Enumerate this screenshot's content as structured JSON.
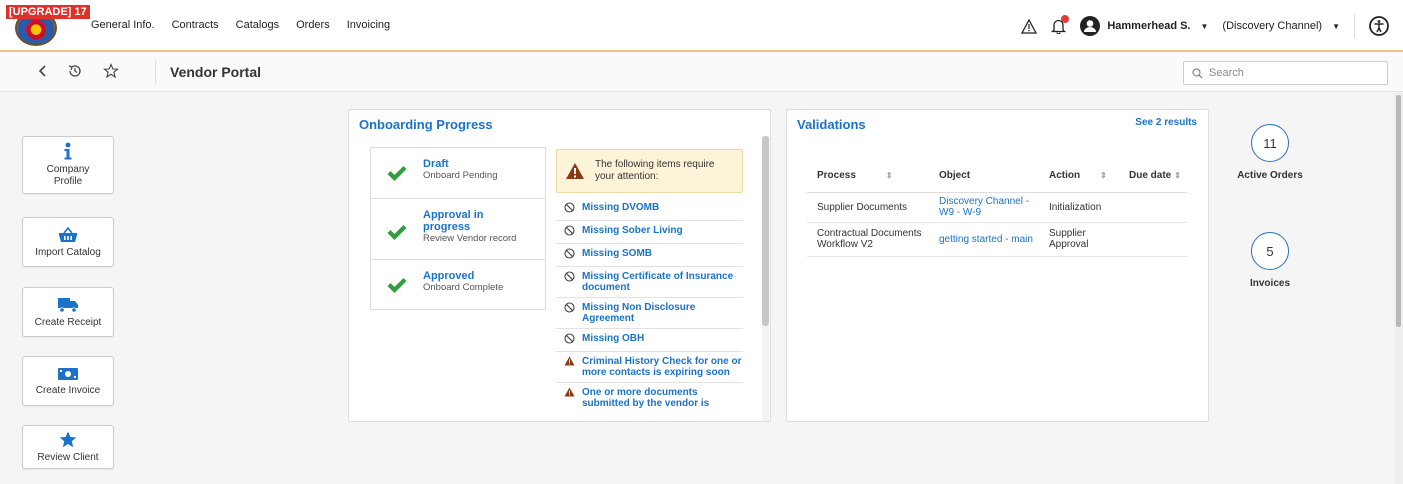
{
  "topbar": {
    "upgrade_tag": "[UPGRADE] 17",
    "nav": [
      "General Info.",
      "Contracts",
      "Catalogs",
      "Orders",
      "Invoicing"
    ],
    "user_name": "Hammerhead S.",
    "org_name": "(Discovery Channel)"
  },
  "subheader": {
    "title": "Vendor Portal",
    "search_placeholder": "Search"
  },
  "actions": [
    {
      "label": "Company Profile",
      "icon": "info-icon"
    },
    {
      "label": "Import Catalog",
      "icon": "basket-icon"
    },
    {
      "label": "Create Receipt",
      "icon": "truck-icon"
    },
    {
      "label": "Create Invoice",
      "icon": "money-icon"
    },
    {
      "label": "Review Client",
      "icon": "star-icon"
    }
  ],
  "onboarding": {
    "title": "Onboarding Progress",
    "steps": [
      {
        "title": "Draft",
        "subtitle": "Onboard Pending"
      },
      {
        "title": "Approval in progress",
        "subtitle": "Review Vendor record"
      },
      {
        "title": "Approved",
        "subtitle": "Onboard Complete"
      }
    ],
    "notice": "The following items require your attention:",
    "issues": [
      {
        "text": "Missing DVOMB",
        "icon": "ban-icon"
      },
      {
        "text": "Missing Sober Living",
        "icon": "ban-icon"
      },
      {
        "text": "Missing SOMB",
        "icon": "ban-icon"
      },
      {
        "text": "Missing Certificate of Insurance document",
        "icon": "ban-icon"
      },
      {
        "text": "Missing Non Disclosure Agreement",
        "icon": "ban-icon"
      },
      {
        "text": "Missing OBH",
        "icon": "ban-icon"
      },
      {
        "text": "Criminal History Check for one or more contacts is expiring soon",
        "icon": "warning-icon"
      },
      {
        "text": "One or more documents submitted by the vendor is",
        "icon": "warning-icon"
      }
    ]
  },
  "validations": {
    "title": "Validations",
    "see_results": "See 2 results",
    "columns": [
      "Process",
      "Object",
      "Action",
      "Due date"
    ],
    "rows": [
      {
        "process": "Supplier Documents",
        "object": "Discovery Channel - W9 - W-9",
        "action": "Initialization",
        "due": ""
      },
      {
        "process": "Contractual Documents Workflow V2",
        "object": "getting started - main",
        "action": "Supplier Approval",
        "due": ""
      }
    ]
  },
  "stats": [
    {
      "value": "11",
      "label": "Active Orders"
    },
    {
      "value": "5",
      "label": "Invoices"
    }
  ],
  "colors": {
    "accent": "#1a73c8",
    "success": "#2e9e3f",
    "warning": "#8a3a10",
    "notice_bg": "#fdf3d8"
  }
}
